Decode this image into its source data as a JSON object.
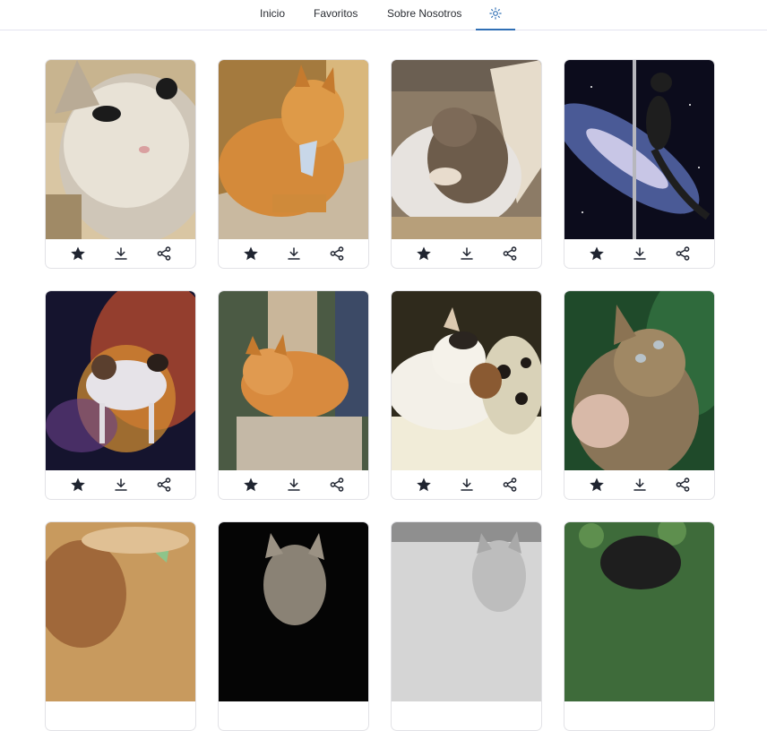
{
  "nav": {
    "inicio": "Inicio",
    "favoritos": "Favoritos",
    "sobre": "Sobre Nosotros",
    "theme_icon": "sun-icon",
    "active_color": "#2f6fb5"
  },
  "cards": [
    {
      "subject": "kitten-closeup",
      "actions": [
        "star-icon",
        "download-icon",
        "share-icon"
      ]
    },
    {
      "subject": "orange-cat-with-tag",
      "actions": [
        "star-icon",
        "download-icon",
        "share-icon"
      ]
    },
    {
      "subject": "sleeping-tabby-kitten",
      "actions": [
        "star-icon",
        "download-icon",
        "share-icon"
      ]
    },
    {
      "subject": "cat-pole-galaxy",
      "actions": [
        "star-icon",
        "download-icon",
        "share-icon"
      ]
    },
    {
      "subject": "cat-nebula",
      "actions": [
        "star-icon",
        "download-icon",
        "share-icon"
      ]
    },
    {
      "subject": "orange-cat-on-carpet-tower",
      "actions": [
        "star-icon",
        "download-icon",
        "share-icon"
      ]
    },
    {
      "subject": "cat-with-plush",
      "actions": [
        "star-icon",
        "download-icon",
        "share-icon"
      ]
    },
    {
      "subject": "tabby-looking-up",
      "actions": [
        "star-icon",
        "download-icon",
        "share-icon"
      ]
    },
    {
      "subject": "cat-with-leaf",
      "actions": []
    },
    {
      "subject": "maine-coon-dark",
      "actions": []
    },
    {
      "subject": "grey-kitten",
      "actions": []
    },
    {
      "subject": "black-cat-greenery",
      "actions": []
    }
  ]
}
